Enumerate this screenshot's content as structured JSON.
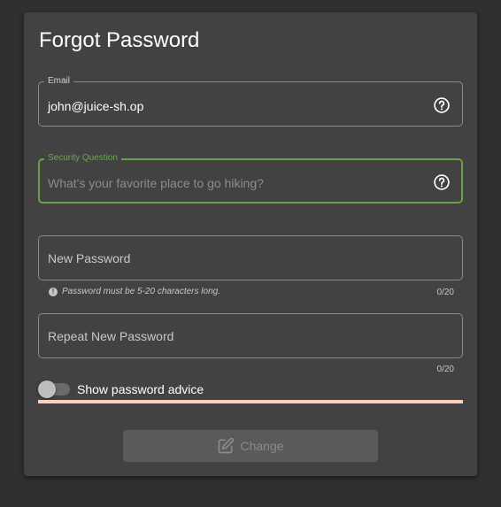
{
  "page": {
    "title": "Forgot Password"
  },
  "form": {
    "email": {
      "label": "Email",
      "value": "john@juice-sh.op"
    },
    "security_question": {
      "label": "Security Question",
      "placeholder": "What's your favorite place to go hiking?",
      "value": ""
    },
    "new_password": {
      "label": "New Password",
      "hint": "Password must be 5-20 characters long.",
      "counter": "0/20"
    },
    "repeat_password": {
      "label": "Repeat New Password",
      "counter": "0/20"
    },
    "advice_toggle": {
      "label": "Show password advice",
      "checked": false
    },
    "submit": {
      "label": "Change",
      "disabled": true
    }
  },
  "icons": {
    "email_help": "help-circle-icon",
    "security_help": "help-circle-icon",
    "hint": "info-icon",
    "submit": "edit-icon"
  },
  "colors": {
    "background": "#303030",
    "card": "#424242",
    "focus_accent": "#69a048",
    "strength_bar": "#ffcdbd",
    "button_disabled": "#5a5a5a"
  }
}
